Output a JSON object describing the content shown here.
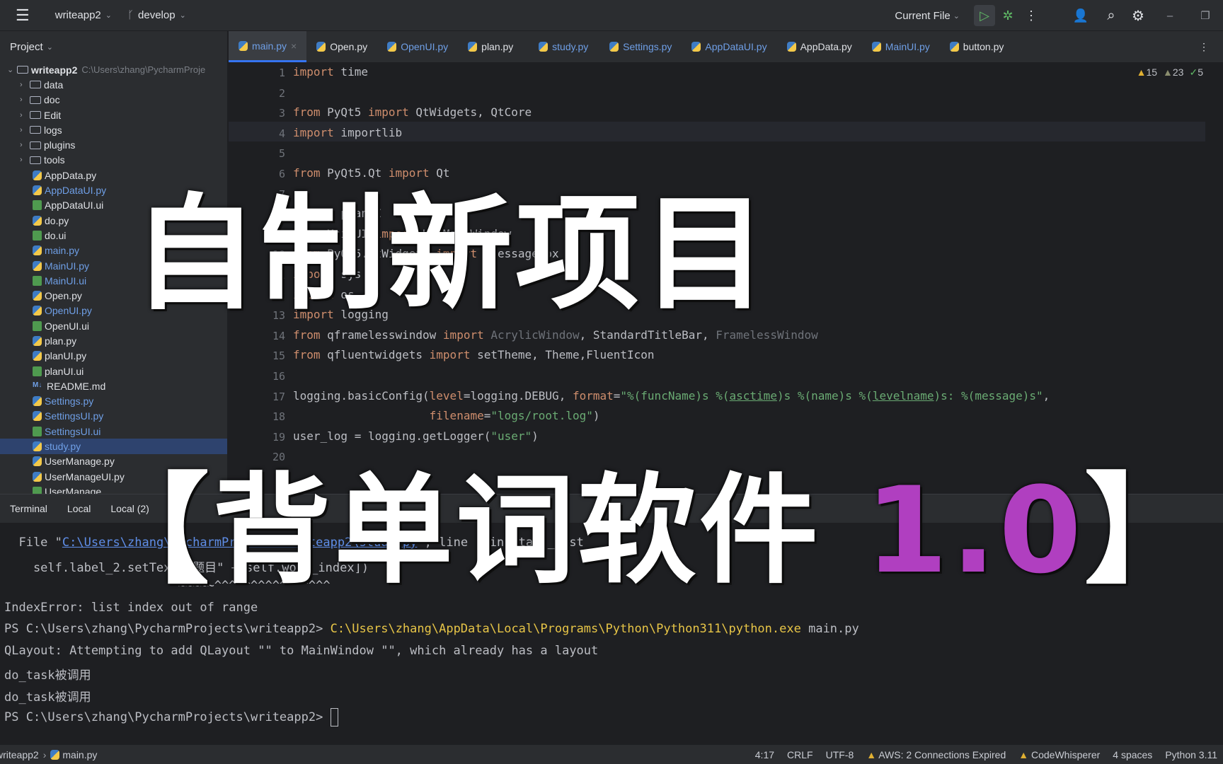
{
  "topbar": {
    "project": "writeapp2",
    "branch": "develop",
    "run_config": "Current File"
  },
  "sidebar": {
    "title": "Project",
    "root": "writeapp2",
    "root_path": "C:\\Users\\zhang\\PycharmProje",
    "items": [
      {
        "label": "data",
        "type": "folder"
      },
      {
        "label": "doc",
        "type": "folder"
      },
      {
        "label": "Edit",
        "type": "folder"
      },
      {
        "label": "logs",
        "type": "folder"
      },
      {
        "label": "plugins",
        "type": "folder"
      },
      {
        "label": "tools",
        "type": "folder"
      },
      {
        "label": "AppData.py",
        "type": "py"
      },
      {
        "label": "AppDataUI.py",
        "type": "py",
        "modified": true
      },
      {
        "label": "AppDataUI.ui",
        "type": "ui"
      },
      {
        "label": "do.py",
        "type": "py"
      },
      {
        "label": "do.ui",
        "type": "ui"
      },
      {
        "label": "main.py",
        "type": "py",
        "modified": true
      },
      {
        "label": "MainUI.py",
        "type": "py",
        "modified": true
      },
      {
        "label": "MainUI.ui",
        "type": "ui",
        "modified": true
      },
      {
        "label": "Open.py",
        "type": "py"
      },
      {
        "label": "OpenUI.py",
        "type": "py",
        "modified": true
      },
      {
        "label": "OpenUI.ui",
        "type": "ui"
      },
      {
        "label": "plan.py",
        "type": "py"
      },
      {
        "label": "planUI.py",
        "type": "py"
      },
      {
        "label": "planUI.ui",
        "type": "ui"
      },
      {
        "label": "README.md",
        "type": "md"
      },
      {
        "label": "Settings.py",
        "type": "py",
        "modified": true
      },
      {
        "label": "SettingsUI.py",
        "type": "py",
        "modified": true
      },
      {
        "label": "SettingsUI.ui",
        "type": "ui",
        "modified": true
      },
      {
        "label": "study.py",
        "type": "py",
        "modified": true,
        "selected": true
      },
      {
        "label": "UserManage.py",
        "type": "py"
      },
      {
        "label": "UserManageUI.py",
        "type": "py"
      },
      {
        "label": "UserManage",
        "type": "ui"
      }
    ]
  },
  "tabs": [
    {
      "label": "main.py",
      "active": true
    },
    {
      "label": "Open.py"
    },
    {
      "label": "OpenUI.py",
      "modified": true
    },
    {
      "label": "plan.py"
    },
    {
      "label": "study.py",
      "modified": true
    },
    {
      "label": "Settings.py",
      "modified": true
    },
    {
      "label": "AppDataUI.py",
      "modified": true
    },
    {
      "label": "AppData.py"
    },
    {
      "label": "MainUI.py",
      "modified": true
    },
    {
      "label": "button.py"
    }
  ],
  "inspections": {
    "warnings": "15",
    "weak": "23",
    "ok": "5"
  },
  "code": [
    [
      [
        "import",
        "k"
      ],
      [
        " time",
        ""
      ]
    ],
    [],
    [
      [
        "from",
        "k"
      ],
      [
        " PyQt5 ",
        ""
      ],
      [
        "import",
        "k"
      ],
      [
        " QtWidgets, QtCore",
        ""
      ]
    ],
    [
      [
        "import",
        "k"
      ],
      [
        " importlib",
        ""
      ]
    ],
    [],
    [
      [
        "from",
        "k"
      ],
      [
        " PyQt5.Qt ",
        ""
      ],
      [
        "import",
        "k"
      ],
      [
        " Qt",
        ""
      ]
    ],
    [],
    [
      [
        "import",
        "k"
      ],
      [
        " planUI",
        ""
      ]
    ],
    [
      [
        "from",
        "k"
      ],
      [
        " MainUI ",
        ""
      ],
      [
        "import",
        "k"
      ],
      [
        " Ui_MainWindow",
        ""
      ]
    ],
    [
      [
        "from",
        "k"
      ],
      [
        " PyQt5.QtWidgets ",
        ""
      ],
      [
        "import",
        "k"
      ],
      [
        " QMessageBox",
        ""
      ]
    ],
    [
      [
        "import",
        "k"
      ],
      [
        " sys",
        ""
      ]
    ],
    [
      [
        "import",
        "k"
      ],
      [
        " os",
        ""
      ]
    ],
    [
      [
        "import",
        "k"
      ],
      [
        " logging",
        ""
      ]
    ],
    [
      [
        "from",
        "k"
      ],
      [
        " qframelesswindow ",
        ""
      ],
      [
        "import",
        "k"
      ],
      [
        " ",
        ""
      ],
      [
        "AcrylicWindow",
        "g"
      ],
      [
        ", StandardTitleBar, ",
        ""
      ],
      [
        "FramelessWindow",
        "g"
      ]
    ],
    [
      [
        "from",
        "k"
      ],
      [
        " qfluentwidgets ",
        ""
      ],
      [
        "import",
        "k"
      ],
      [
        " setTheme, Theme,FluentIcon",
        ""
      ]
    ],
    [],
    [
      [
        "logging.basicConfig(",
        ""
      ],
      [
        "level",
        "k"
      ],
      [
        "=logging.DEBUG, ",
        ""
      ],
      [
        "format",
        "k"
      ],
      [
        "=",
        ""
      ],
      [
        "\"%(funcName)s %(",
        "s"
      ],
      [
        "asctime",
        "u"
      ],
      [
        ")s %(name)s %(",
        "s"
      ],
      [
        "levelname",
        "u"
      ],
      [
        ")s: %(message)s\"",
        "s"
      ],
      [
        ",",
        ""
      ]
    ],
    [
      [
        "                    ",
        ""
      ],
      [
        "filename",
        "k"
      ],
      [
        "=",
        ""
      ],
      [
        "\"logs/root.log\"",
        "s"
      ],
      [
        ")",
        ""
      ]
    ],
    [
      [
        "user_log = logging.getLogger(",
        ""
      ],
      [
        "\"user\"",
        "s"
      ],
      [
        ")",
        ""
      ]
    ],
    []
  ],
  "terminal": {
    "tabs": [
      "Terminal",
      "Local",
      "Local (2)"
    ],
    "lines": [
      [
        [
          "  File \"",
          ""
        ],
        [
          "C:\\Users\\zhang\\PycharmProjects\\writeapp2\\study.py",
          "lnk"
        ],
        [
          "\", line , in start_list",
          ""
        ]
      ],
      [
        [
          "    self.label_2.setText(\"题目\" + self.word_index])",
          ""
        ]
      ],
      [
        [
          "                        ~~~~~^^^^^^^^^^^^^^^^",
          ""
        ]
      ],
      [
        [
          "IndexError: list index out of range",
          ""
        ]
      ],
      [
        [
          "PS C:\\Users\\zhang\\PycharmProjects\\writeapp2> ",
          ""
        ],
        [
          "C:\\Users\\zhang\\AppData\\Local\\Programs\\Python\\Python311\\python.exe",
          "y"
        ],
        [
          " main.py",
          ""
        ]
      ],
      [
        [
          "QLayout: Attempting to add QLayout \"\" to MainWindow \"\", which already has a layout",
          ""
        ]
      ],
      [
        [
          "do_task被调用",
          ""
        ]
      ],
      [
        [
          "do_task被调用",
          ""
        ]
      ],
      [
        [
          "PS C:\\Users\\zhang\\PycharmProjects\\writeapp2> ",
          ""
        ]
      ]
    ]
  },
  "status": {
    "crumb_project": "writeapp2",
    "crumb_file": "main.py",
    "position": "4:17",
    "line_sep": "CRLF",
    "encoding": "UTF-8",
    "aws": "AWS: 2 Connections Expired",
    "codewhisperer": "CodeWhisperer",
    "indent": "4 spaces",
    "interpreter": "Python 3.11"
  },
  "overlay": {
    "title": "自制新项目",
    "subtitle_open": "【背单词软件",
    "version": "1.0",
    "subtitle_close": "】",
    "version_color": "#b03fc0"
  }
}
